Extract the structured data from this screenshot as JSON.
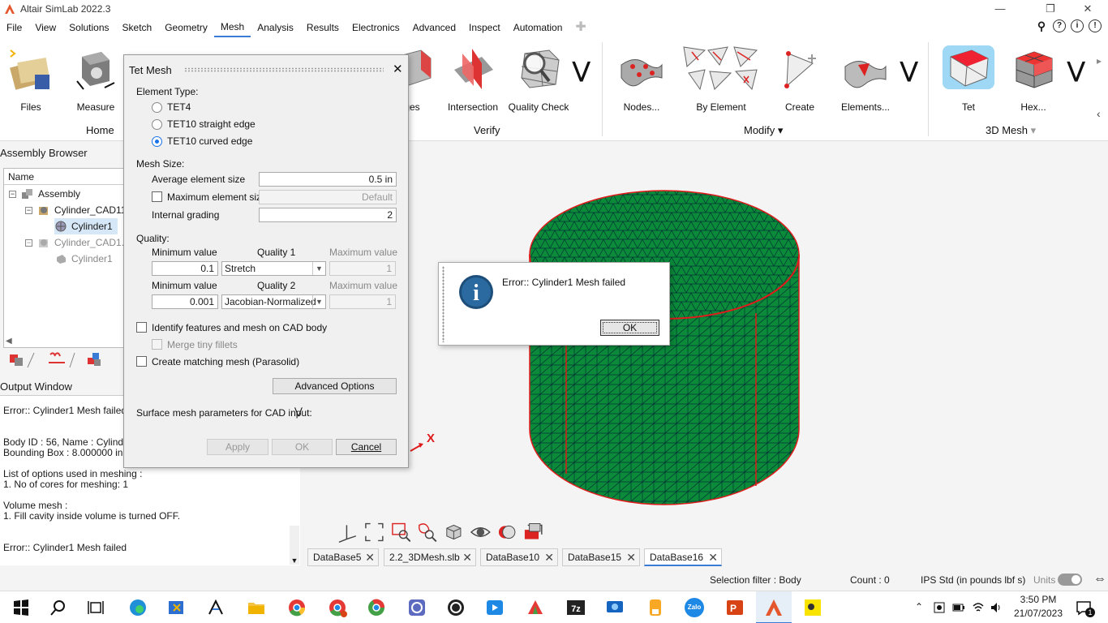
{
  "app": {
    "title": "Altair SimLab 2022.3"
  },
  "menu": {
    "items": [
      "File",
      "View",
      "Solutions",
      "Sketch",
      "Geometry",
      "Mesh",
      "Analysis",
      "Results",
      "Electronics",
      "Advanced",
      "Inspect",
      "Automation"
    ],
    "active": "Mesh"
  },
  "ribbon": {
    "home": {
      "files": "Files",
      "measure": "Measure",
      "group": "Home"
    },
    "verify": {
      "edges": "ges",
      "intersection": "Intersection",
      "quality_check": "Quality Check",
      "group": "Verify"
    },
    "modify": {
      "nodes": "Nodes...",
      "by_element": "By Element",
      "create": "Create",
      "elements": "Elements...",
      "group": "Modify"
    },
    "mesh3d": {
      "tet": "Tet",
      "hex": "Hex...",
      "group": "3D Mesh"
    }
  },
  "assembly": {
    "title": "Assembly Browser",
    "col_name": "Name",
    "items": [
      {
        "label": "Assembly"
      },
      {
        "label": "Cylinder_CAD11_"
      },
      {
        "label": "Cylinder1"
      },
      {
        "label": "Cylinder_CAD1.x_"
      },
      {
        "label": "Cylinder1"
      }
    ]
  },
  "output": {
    "title": "Output Window",
    "lines": [
      "Error:: Cylinder1  Mesh failed",
      "Body ID : 56, Name : Cylinder1",
      "Bounding Box : 8.000000 in, 8.",
      "List of options used in meshing :",
      " 1. No of cores for meshing: 1",
      "Volume mesh :",
      " 1. Fill cavity inside volume is turned OFF.",
      "Error:: Cylinder1  Mesh failed"
    ]
  },
  "tet_dialog": {
    "title": "Tet Mesh",
    "element_type_label": "Element Type:",
    "element_types": [
      "TET4",
      "TET10 straight edge",
      "TET10 curved edge"
    ],
    "selected_type": 2,
    "mesh_size_label": "Mesh Size:",
    "avg_label": "Average element size",
    "avg_value": "0.5 in",
    "max_label": "Maximum element size",
    "max_value": "Default",
    "grading_label": "Internal grading",
    "grading_value": "2",
    "quality_label": "Quality:",
    "q1": {
      "min_label": "Minimum value",
      "quality_label": "Quality 1",
      "max_label": "Maximum value",
      "min_value": "0.1",
      "metric": "Stretch",
      "max_value": "1"
    },
    "q2": {
      "min_label": "Minimum value",
      "quality_label": "Quality 2",
      "max_label": "Maximum value",
      "min_value": "0.001",
      "metric": "Jacobian-Normalized",
      "max_value": "1"
    },
    "identify_label": "Identify features and mesh on CAD body",
    "merge_label": "Merge tiny fillets",
    "matching_label": "Create matching mesh (Parasolid)",
    "advanced_btn": "Advanced Options",
    "surface_label": "Surface mesh parameters for CAD input:",
    "apply_btn": "Apply",
    "ok_btn": "OK",
    "cancel_btn": "Cancel"
  },
  "error_dialog": {
    "message": "Error:: Cylinder1 Mesh failed",
    "ok": "OK"
  },
  "viewport": {
    "axis_label": "X",
    "mesh_color": "#0b8a3a",
    "edge_color": "#e01b1b"
  },
  "tabs": [
    {
      "label": "DataBase5"
    },
    {
      "label": "2.2_3DMesh.slb"
    },
    {
      "label": "DataBase10"
    },
    {
      "label": "DataBase15"
    },
    {
      "label": "DataBase16"
    }
  ],
  "status": {
    "selection_filter": "Selection filter : Body",
    "count": "Count : 0",
    "units_system": "IPS Std (in pounds lbf s)",
    "units_label": "Units"
  },
  "taskbar": {
    "time": "3:50 PM",
    "date": "21/07/2023",
    "notif_count": "1",
    "zalo": "Zalo"
  }
}
